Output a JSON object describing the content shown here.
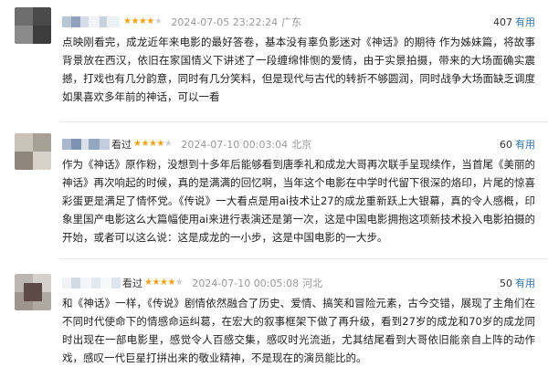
{
  "reviews": [
    {
      "watched": "",
      "stars": 4,
      "timestamp": "2024-07-05 23:22:24",
      "location": "广东",
      "votes": "407",
      "vote_label": "有用",
      "text": "点映刚看完，成龙近年来电影的最好答卷，基本没有辜负影迷对《神话》的期待 作为姊妹篇，将故事背景放在西汉，依旧在家国情义下讲述了一段缠绵悱恻的爱情，由于实景拍摄，带来的大场面确实震撼，打戏也有几分韵意，同时有几分笑料，但是现代与古代的转折不够圆润，同时战争大场面缺乏调度 如果喜欢多年前的神话，可以一看"
    },
    {
      "watched": "看过",
      "stars": 4,
      "timestamp": "2024-07-10 00:03:04",
      "location": "北京",
      "votes": "60",
      "vote_label": "有用",
      "text": "作为《神话》原作粉，没想到十多年后能够看到唐季礼和成龙大哥再次联手呈现续作，当首尾《美丽的神话》再次响起的时候，真的是满满的回忆啊，当年这个电影在中学时代留下很深的烙印，片尾的惊喜彩蛋更是满足了情怀党。《传说》一大看点是用ai技术让27的成龙重新跃上大银幕，真的令人感概，印象里国产电影这么大篇幅使用ai来进行表演还是第一次，这是中国电影拥抱这项新技术投入电影拍摄的开始，或者可以这么说：这是成龙的一小步，这是中国电影的一大步。"
    },
    {
      "watched": "看过",
      "stars": 4,
      "timestamp": "2024-07-10 00:05:08",
      "location": "河北",
      "votes": "50",
      "vote_label": "有用",
      "text": "和《神话》一样，《传说》剧情依然融合了历史、爱情、搞笑和冒险元素，古今交错，展现了主角们在不同时代使命下的情感命运纠葛，在宏大的叙事框架下做了再升级，看到27岁的成龙和70岁的成龙同时出现在一部电影里，感觉令人百感交集，感叹时光流逝，尤其结尾看到大哥依旧能亲自上阵的动作戏，感叹一代巨星打拼出来的敬业精神，不是现在的演员能比的。"
    }
  ],
  "colors": {
    "star_on": "#f0a21b",
    "star_off": "#cfcfcf",
    "meta": "#9a9a9a",
    "vote_link": "#3377aa"
  }
}
